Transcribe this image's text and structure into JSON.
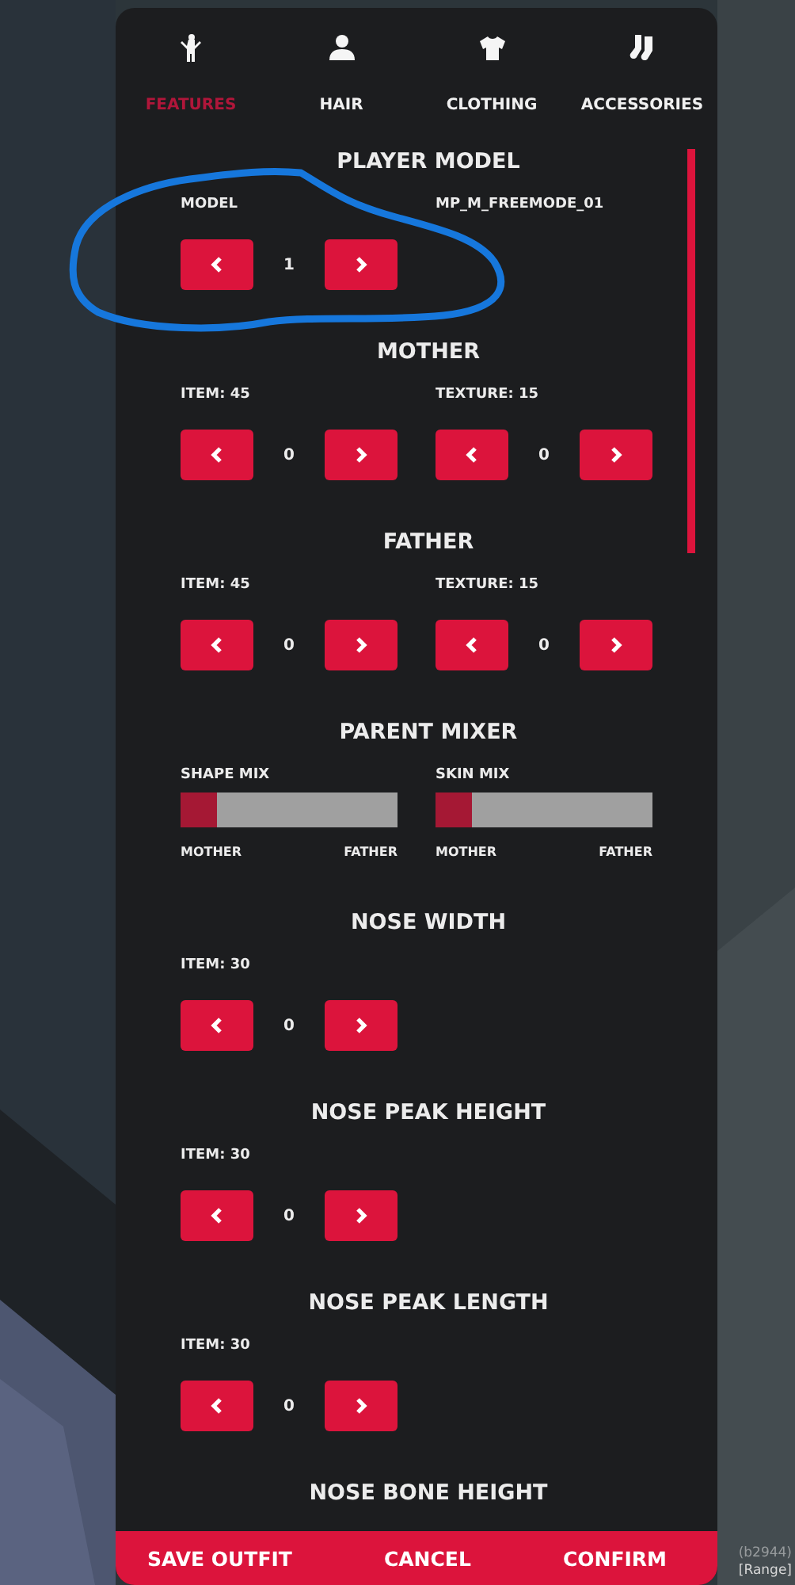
{
  "tabs": [
    {
      "label": "FEATURES",
      "selected": true
    },
    {
      "label": "HAIR",
      "selected": false
    },
    {
      "label": "CLOTHING",
      "selected": false
    },
    {
      "label": "ACCESSORIES",
      "selected": false
    }
  ],
  "sections": [
    {
      "title": "PLAYER MODEL",
      "kind": "selector",
      "fields": [
        {
          "label": "MODEL",
          "value": "1"
        },
        {
          "label": "MP_M_FREEMODE_01"
        }
      ]
    },
    {
      "title": "MOTHER",
      "kind": "selector",
      "fields": [
        {
          "label": "ITEM: 45",
          "value": "0"
        },
        {
          "label": "TEXTURE: 15",
          "value": "0"
        }
      ]
    },
    {
      "title": "FATHER",
      "kind": "selector",
      "fields": [
        {
          "label": "ITEM: 45",
          "value": "0"
        },
        {
          "label": "TEXTURE: 15",
          "value": "0"
        }
      ]
    },
    {
      "title": "PARENT MIXER",
      "kind": "mixer",
      "sliders": [
        {
          "label": "SHAPE MIX",
          "level": 0.17,
          "left_label": "MOTHER",
          "right_label": "FATHER"
        },
        {
          "label": "SKIN MIX",
          "level": 0.17,
          "left_label": "MOTHER",
          "right_label": "FATHER"
        }
      ]
    },
    {
      "title": "NOSE WIDTH",
      "kind": "selector",
      "fields": [
        {
          "label": "ITEM: 30",
          "value": "0"
        }
      ]
    },
    {
      "title": "NOSE PEAK HEIGHT",
      "kind": "selector",
      "fields": [
        {
          "label": "ITEM: 30",
          "value": "0"
        }
      ]
    },
    {
      "title": "NOSE PEAK LENGTH",
      "kind": "selector",
      "fields": [
        {
          "label": "ITEM: 30",
          "value": "0"
        }
      ]
    },
    {
      "title": "NOSE BONE HEIGHT",
      "kind": "selector"
    }
  ],
  "footer": [
    "SAVE OUTFIT",
    "CANCEL",
    "CONFIRM"
  ],
  "annotation": {
    "kind": "ellipse"
  },
  "overlay": {
    "build": "(b2944)",
    "tag": "[Range]"
  }
}
